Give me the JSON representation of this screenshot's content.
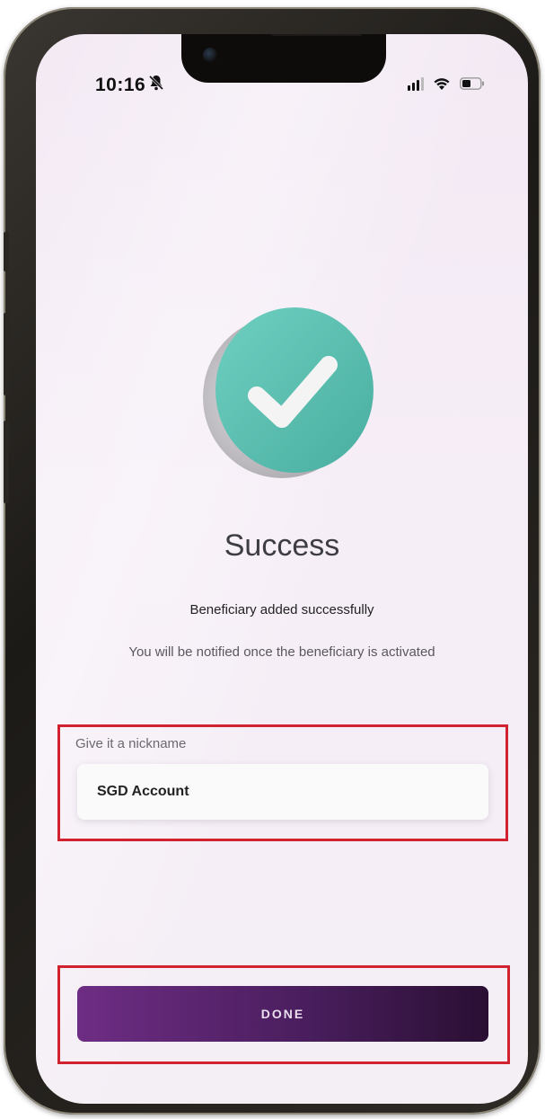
{
  "status_bar": {
    "time": "10:16",
    "silent_icon": "bell-slash-icon",
    "signal_icon": "cellular-signal-icon",
    "wifi_icon": "wifi-icon",
    "battery_icon": "battery-icon"
  },
  "success": {
    "icon": "checkmark-circle-icon",
    "icon_color": "#5cc2b3",
    "title": "Success",
    "subtitle": "Beneficiary added successfully",
    "note": "You will be notified once the beneficiary is activated"
  },
  "nickname": {
    "label": "Give it a nickname",
    "value": "SGD Account"
  },
  "actions": {
    "done_label": "DONE",
    "done_color": "#5a2470"
  },
  "annotations": {
    "highlight_color": "#d0232f"
  }
}
